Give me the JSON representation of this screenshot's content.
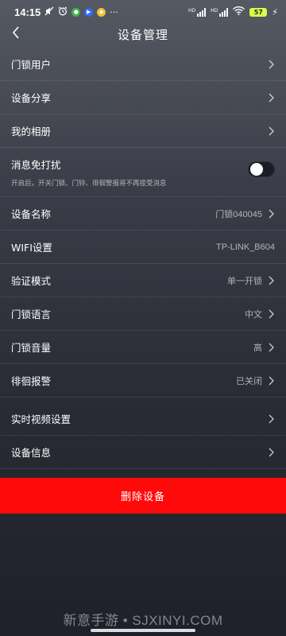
{
  "status_bar": {
    "time": "14:15",
    "battery": "57",
    "more": "···"
  },
  "header": {
    "title": "设备管理"
  },
  "settings": {
    "door_lock_users": {
      "label": "门锁用户"
    },
    "device_share": {
      "label": "设备分享"
    },
    "my_album": {
      "label": "我的相册"
    },
    "do_not_disturb": {
      "label": "消息免打扰",
      "description": "开启后，开关门锁、门铃、徘徊警报将不再接受消息",
      "enabled": false
    },
    "device_name": {
      "label": "设备名称",
      "value": "门锁040045"
    },
    "wifi": {
      "label": "WIFI设置",
      "value": "TP-LINK_B604"
    },
    "verify_mode": {
      "label": "验证模式",
      "value": "单一开锁"
    },
    "lock_language": {
      "label": "门锁语言",
      "value": "中文"
    },
    "lock_volume": {
      "label": "门锁音量",
      "value": "高"
    },
    "loiter_alarm": {
      "label": "徘徊报警",
      "value": "已关闭"
    },
    "live_video": {
      "label": "实时视频设置"
    },
    "device_info": {
      "label": "设备信息"
    }
  },
  "delete_button": {
    "label": "删除设备"
  },
  "watermark": "新意手游 • SJXINYI.COM"
}
